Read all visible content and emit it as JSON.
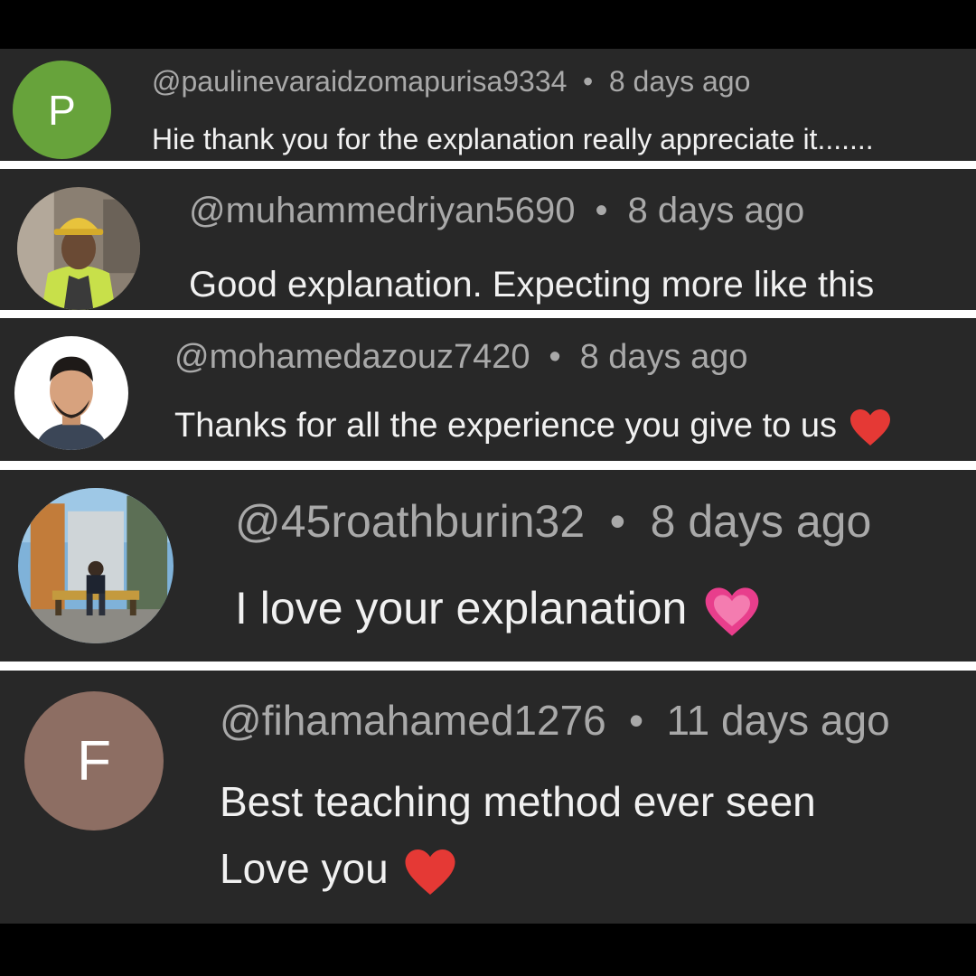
{
  "comments": [
    {
      "handle": "@paulinevaraidzomapurisa9334",
      "time": "8 days ago",
      "text": "Hie thank you for the explanation really appreciate it.......",
      "avatar_letter": "P",
      "avatar_color": "#67a33b"
    },
    {
      "handle": "@muhammedriyan5690",
      "time": "8 days ago",
      "text": "Good explanation. Expecting more like this",
      "avatar_icon": "profile-photo-worker-hardhat"
    },
    {
      "handle": "@mohamedazouz7420",
      "time": "8 days ago",
      "text": "Thanks for all the experience you give to us",
      "avatar_icon": "profile-photo-man-portrait",
      "heart": "red-heart-emoji"
    },
    {
      "handle": "@45roathburin32",
      "time": "8 days ago",
      "text": "I love your explanation",
      "avatar_icon": "profile-photo-man-on-bench",
      "heart": "pink-heart-emoji"
    },
    {
      "handle": "@fihamahamed1276",
      "time": "11 days ago",
      "text_line1": "Best teaching method ever seen",
      "text_line2": "Love you",
      "avatar_letter": "F",
      "avatar_color": "#8d6e63",
      "heart": "red-heart-emoji"
    }
  ],
  "separator": "•",
  "colors": {
    "background": "#000000",
    "panel": "#282828",
    "meta_text": "#a9a9a9",
    "body_text": "#f1f1f1",
    "red_heart": "#e53935",
    "pink_heart": "#e83e8c"
  }
}
